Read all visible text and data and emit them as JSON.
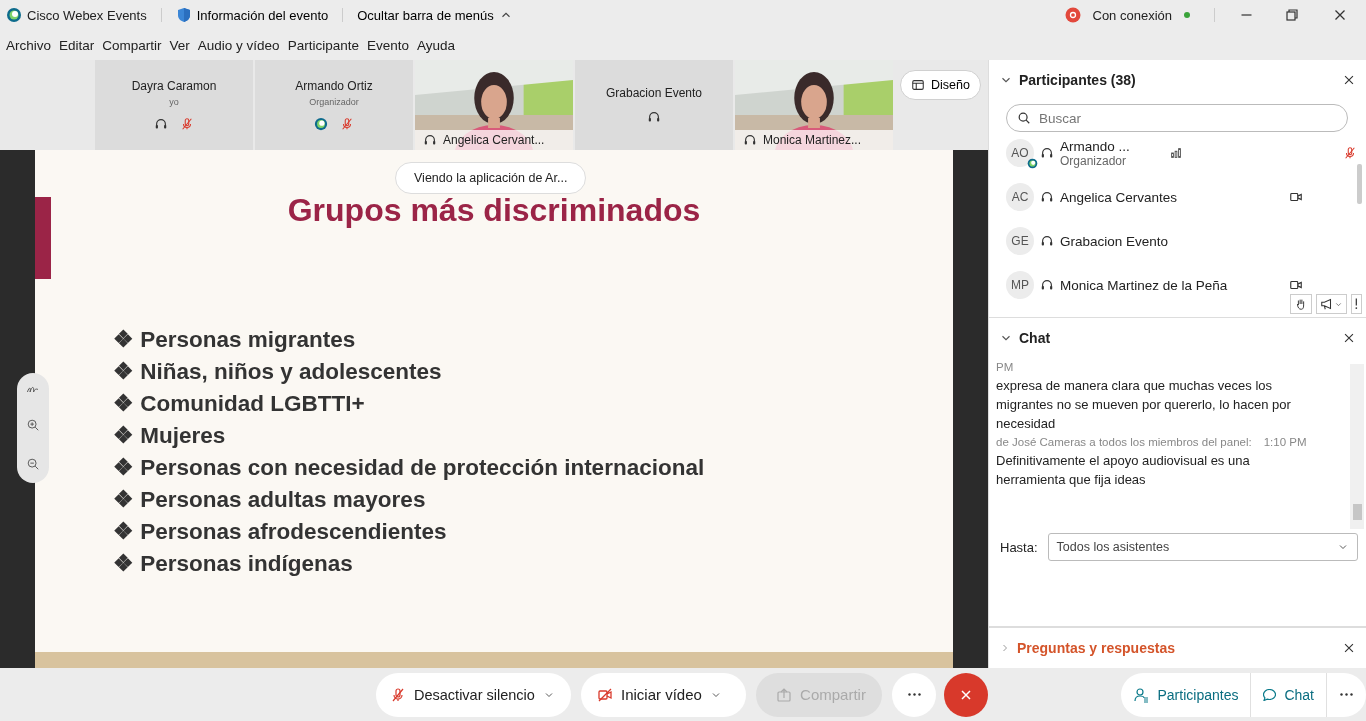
{
  "titlebar": {
    "app_name": "Cisco Webex Events",
    "event_info": "Información del evento",
    "hide_menu": "Ocultar barra de menús",
    "status": "Con conexión",
    "recording": true,
    "connected": true
  },
  "menu": [
    "Archivo",
    "Editar",
    "Compartir",
    "Ver",
    "Audio y vídeo",
    "Participante",
    "Evento",
    "Ayuda"
  ],
  "video_tiles": [
    {
      "kind": "avatar",
      "name": "Dayra Caramon",
      "role": "yo",
      "host": false,
      "muted": true
    },
    {
      "kind": "avatar",
      "name": "Armando Ortiz",
      "role": "Organizador",
      "host": true,
      "muted": true
    },
    {
      "kind": "video",
      "name": "Angelica Cervant..."
    },
    {
      "kind": "avatar",
      "name": "Grabacion Evento",
      "host": false,
      "muted": false
    },
    {
      "kind": "video",
      "name": "Monica Martinez..."
    }
  ],
  "layout_button": "Diseño",
  "sharing_banner": "Viendo la aplicación de Ar...",
  "slide": {
    "title": "Grupos más discriminados",
    "bullets": [
      "❖ Personas migrantes",
      "❖ Niñas, niños y adolescentes",
      "❖ Comunidad LGBTTI+",
      "❖ Mujeres",
      "❖ Personas con necesidad de protección internacional",
      "❖ Personas adultas mayores",
      "❖ Personas afrodescendientes",
      "❖ Personas indígenas"
    ]
  },
  "participants": {
    "title": "Participantes (38)",
    "expanded": true,
    "search_placeholder": "Buscar",
    "items": [
      {
        "initials": "AO",
        "name": "Armando ...",
        "role": "Organizador",
        "host": true,
        "speaking": true,
        "video": false,
        "muted": true
      },
      {
        "initials": "AC",
        "name": "Angelica Cervantes",
        "host": false,
        "speaking": false,
        "video": true,
        "muted": false
      },
      {
        "initials": "GE",
        "name": "Grabacion Evento",
        "host": false,
        "speaking": false,
        "video": false,
        "muted": false
      },
      {
        "initials": "MP",
        "name": "Monica Martinez de la Peña",
        "host": false,
        "speaking": false,
        "video": true,
        "muted": false
      }
    ]
  },
  "chat": {
    "title": "Chat",
    "expanded": true,
    "messages": [
      {
        "kind": "meta",
        "text": "PM"
      },
      {
        "kind": "body",
        "text": "expresa de manera clara que muchas veces los migrantes no se mueven por quererlo, lo hacen por necesidad"
      },
      {
        "kind": "meta",
        "text": "de José Cameras a todos los miembros del panel:",
        "time": "1:10 PM"
      },
      {
        "kind": "body",
        "text": "Definitivamente el apoyo audiovisual es una herramienta que fija ideas"
      }
    ],
    "to_label": "Hasta:",
    "to_value": "Todos los asistentes"
  },
  "qa": {
    "title": "Preguntas y respuestas",
    "expanded": false
  },
  "controls": {
    "mute": "Desactivar silencio",
    "video": "Iniciar vídeo",
    "share": "Compartir",
    "share_disabled": true
  },
  "panel_buttons": [
    "Participantes",
    "Chat"
  ]
}
